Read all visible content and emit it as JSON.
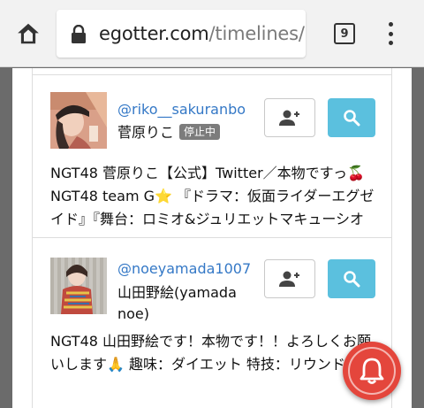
{
  "browser": {
    "url_domain": "egotter.com",
    "url_path": "/timelines/I",
    "tab_count": "9"
  },
  "users": [
    {
      "handle": "@riko__sakuranbo",
      "name": "菅原りこ",
      "badge": "停止中",
      "bio": "NGT48 菅原りこ【公式】Twitter／本物ですっ🍒NGT48 team G⭐ 『ドラマ：仮面ライダーエグゼイド』『舞台：ロミオ&ジュリエットマキューシオ役』もっと演技や声を使ったお仕事"
    },
    {
      "handle": "@noeyamada1007",
      "name": "山田野絵(yamada noe)",
      "badge": "",
      "bio": "NGT48 山田野絵です！本物です！！よろしくお願いします🙏 趣味：ダイエット 特技：リウンド"
    }
  ],
  "colors": {
    "link": "#3478c6",
    "search_button": "#5bc0de",
    "badge": "#7c7c7c",
    "notify": "#e4463c"
  },
  "icons": {
    "home": "home-icon",
    "lock": "lock-icon",
    "menu": "more-vert-icon",
    "follow": "person-add-icon",
    "search": "search-icon",
    "notify": "bell-icon"
  }
}
